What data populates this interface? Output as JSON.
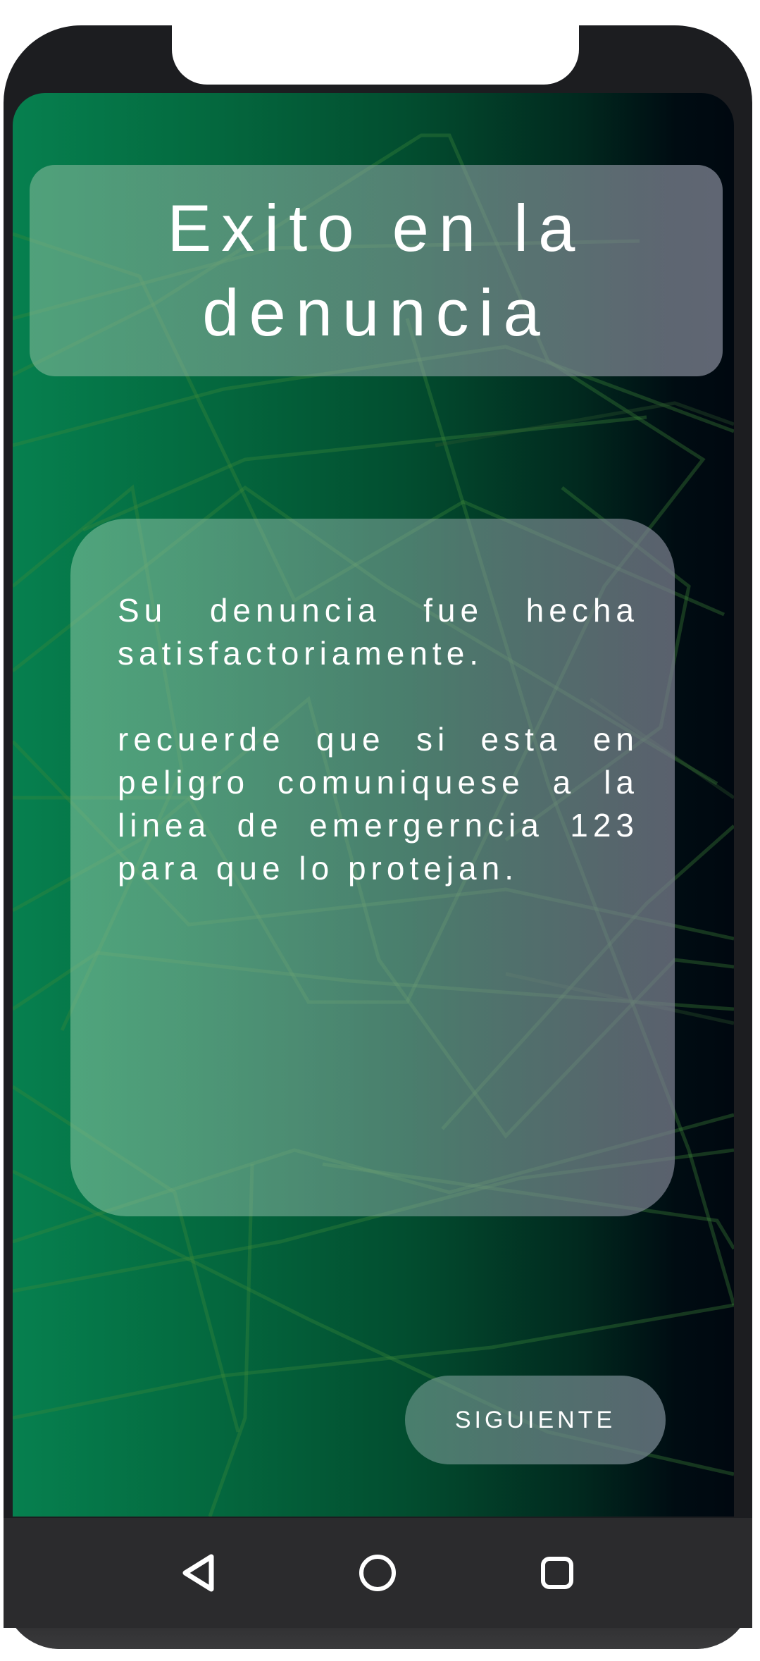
{
  "title": "Exito en la denuncia",
  "message": {
    "paragraph_1": "Su denuncia fue hecha satisfactoriamente.",
    "paragraph_2": "recuerde que si esta en peligro comuniquese a la linea de emergerncia 123 para que lo protejan."
  },
  "next_button_label": "SIGUIENTE",
  "nav": {
    "back_icon": "triangle-back-icon",
    "home_icon": "circle-home-icon",
    "recents_icon": "square-recents-icon"
  },
  "colors": {
    "gradient_start": "#06804f",
    "gradient_end": "#000810",
    "frame": "#1c1d20",
    "nav_bar": "#2b2b2d",
    "text": "#ffffff"
  }
}
